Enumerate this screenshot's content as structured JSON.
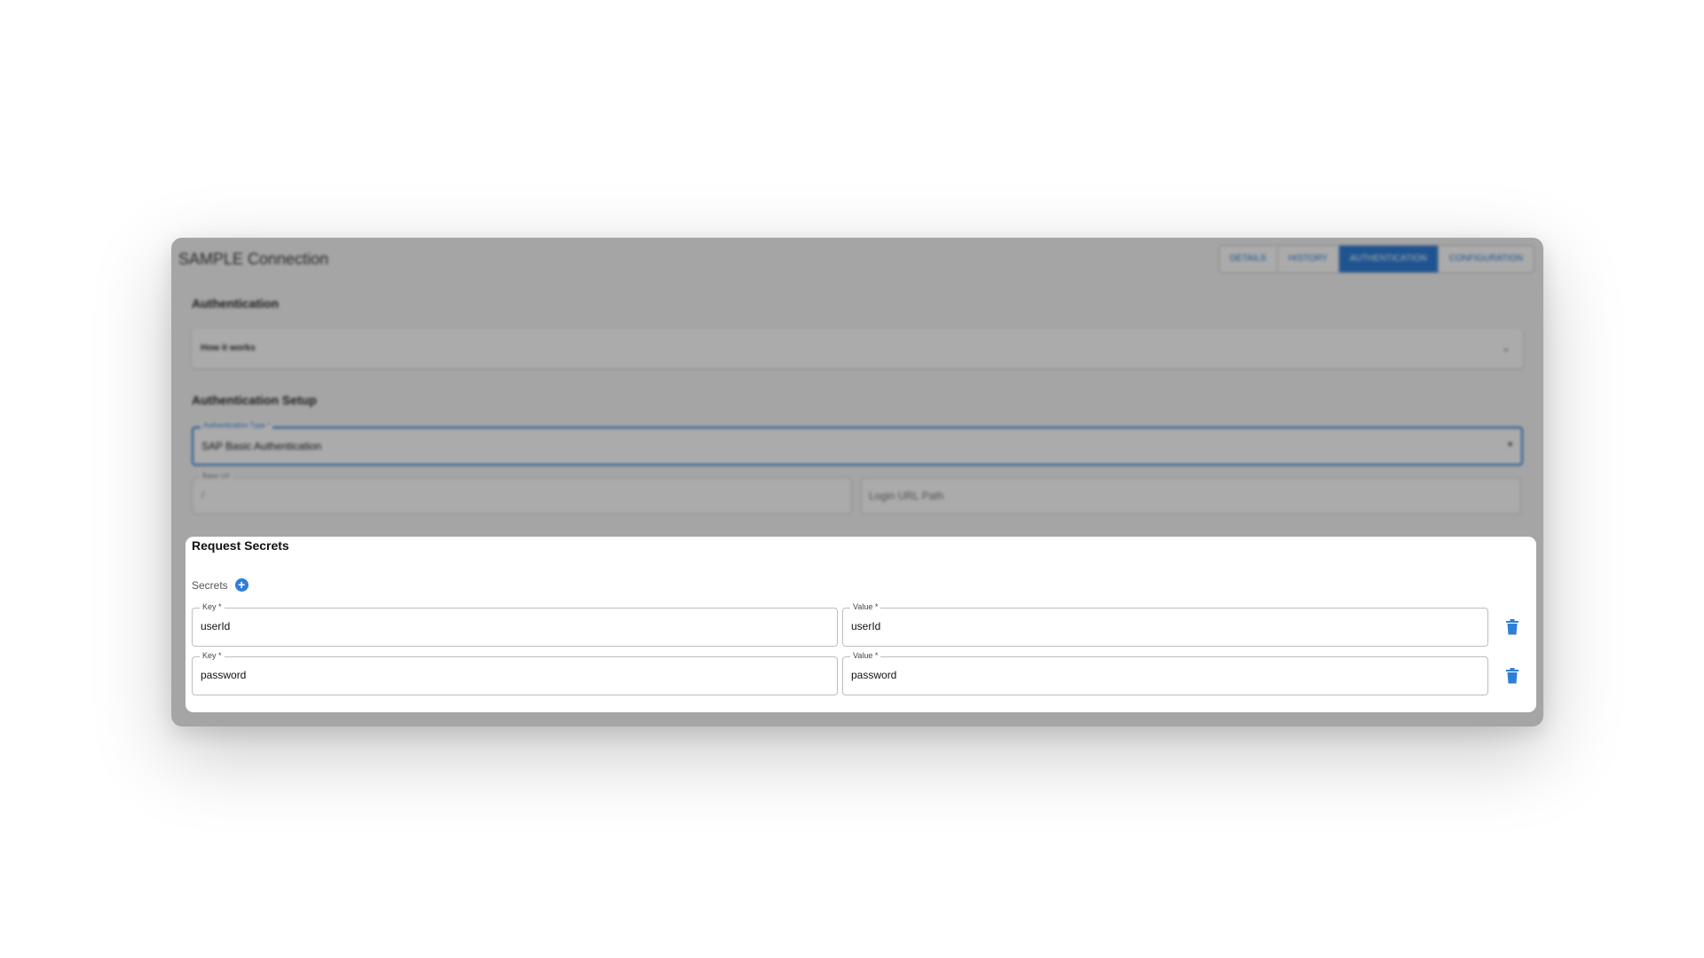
{
  "window": {
    "title": "SAMPLE Connection"
  },
  "tabs": [
    {
      "label": "DETAILS",
      "active": false
    },
    {
      "label": "HISTORY",
      "active": false
    },
    {
      "label": "AUTHENTICATION",
      "active": true
    },
    {
      "label": "CONFIGURATION",
      "active": false
    }
  ],
  "authentication": {
    "heading": "Authentication",
    "accordion_label": "How it works"
  },
  "setup": {
    "heading": "Authentication Setup",
    "type_label": "Authentication Type *",
    "type_value": "SAP Basic Authentication",
    "base_url_label": "Base Url",
    "base_url_value": "/",
    "login_placeholder": "Login URL Path"
  },
  "request_secrets": {
    "heading": "Request Secrets",
    "secrets_label": "Secrets",
    "rows": [
      {
        "key_label": "Key *",
        "key_value": "userId",
        "value_label": "Value *",
        "value_value": "userId"
      },
      {
        "key_label": "Key *",
        "key_value": "password",
        "value_label": "Value *",
        "value_value": "password"
      }
    ]
  },
  "colors": {
    "accent": "#2f7ed8",
    "overlay": "rgba(0,0,0,0.33)"
  },
  "icons": {
    "add": "plus-circle-icon",
    "delete": "trash-icon",
    "chevron": "chevron-down-icon"
  }
}
